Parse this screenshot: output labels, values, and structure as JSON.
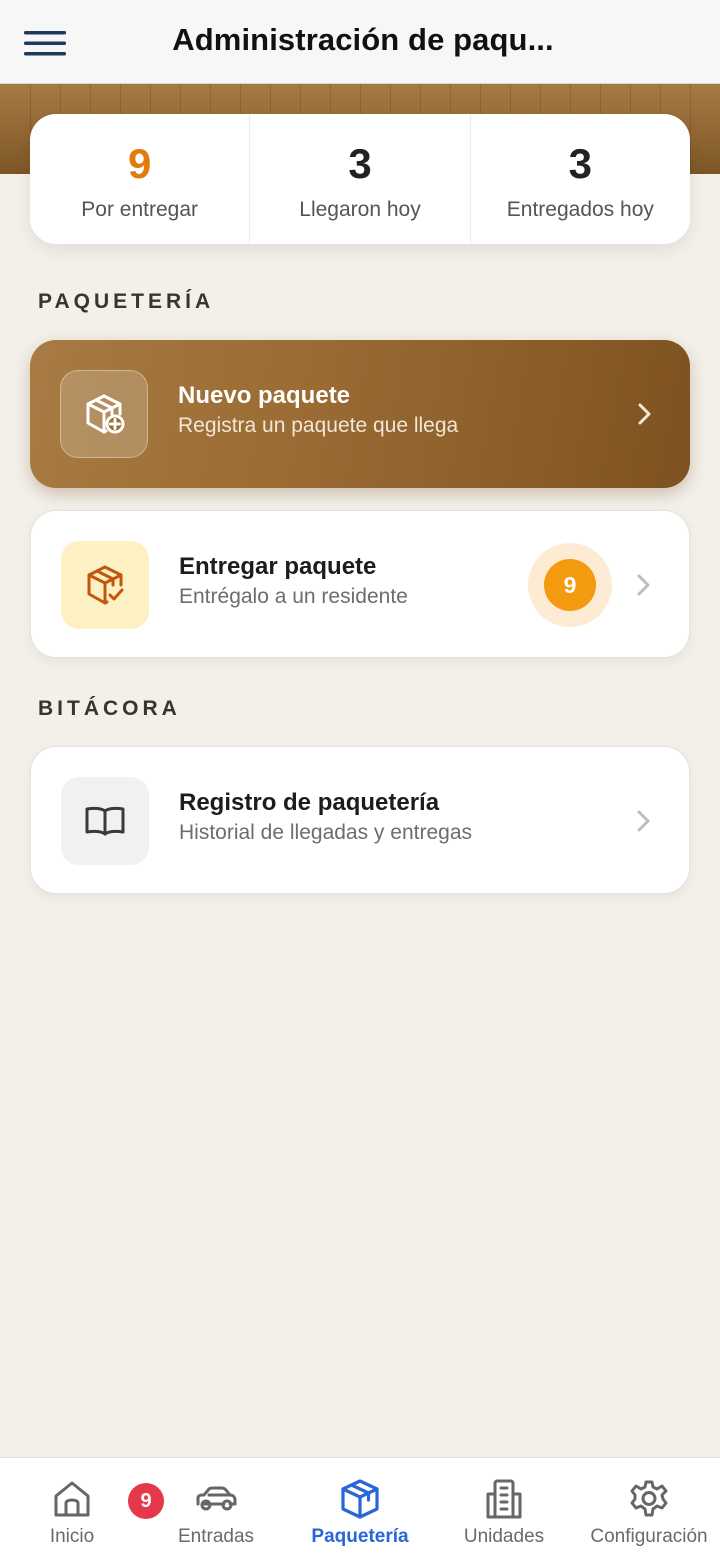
{
  "header": {
    "title": "Administración de paqu..."
  },
  "stats": [
    {
      "value": "9",
      "label": "Por entregar"
    },
    {
      "value": "3",
      "label": "Llegaron hoy"
    },
    {
      "value": "3",
      "label": "Entregados hoy"
    }
  ],
  "sections": {
    "paqueteria": "PAQUETERÍA",
    "bitacora": "BITÁCORA"
  },
  "cards": {
    "nuevo": {
      "title": "Nuevo paquete",
      "subtitle": "Registra un paquete que llega",
      "icon": "package-plus-icon"
    },
    "entregar": {
      "title": "Entregar paquete",
      "subtitle": "Entrégalo a un residente",
      "count": "9",
      "icon": "package-check-icon"
    },
    "registro": {
      "title": "Registro de paquetería",
      "subtitle": "Historial de llegadas y entregas",
      "icon": "book-icon"
    }
  },
  "tabs": [
    {
      "label": "Inicio",
      "icon": "home-icon"
    },
    {
      "label": "Entradas",
      "icon": "car-icon",
      "badge": "9"
    },
    {
      "label": "Paquetería",
      "icon": "package-icon",
      "active": true
    },
    {
      "label": "Unidades",
      "icon": "building-icon"
    },
    {
      "label": "Configuración",
      "icon": "gear-icon"
    }
  ],
  "colors": {
    "accent": "#e07b0c",
    "brand_brown": "#9b6c34",
    "active_tab": "#2a66d8",
    "badge": "#e5384a",
    "count_dot": "#f39a0f"
  }
}
